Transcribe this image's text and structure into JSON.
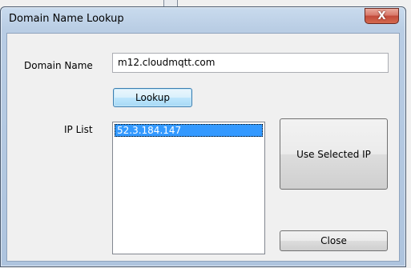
{
  "window": {
    "title": "Domain Name Lookup",
    "close_glyph": "X"
  },
  "form": {
    "domain_label": "Domain Name",
    "domain_value": "m12.cloudmqtt.com",
    "lookup_label": "Lookup",
    "ip_label": "IP List",
    "ip_items": [
      "52.3.184.147"
    ],
    "selected_index": 0
  },
  "buttons": {
    "use_selected_label": "Use Selected IP",
    "close_label": "Close"
  },
  "colors": {
    "selection": "#3399ff",
    "close_button": "#c24a3a"
  }
}
